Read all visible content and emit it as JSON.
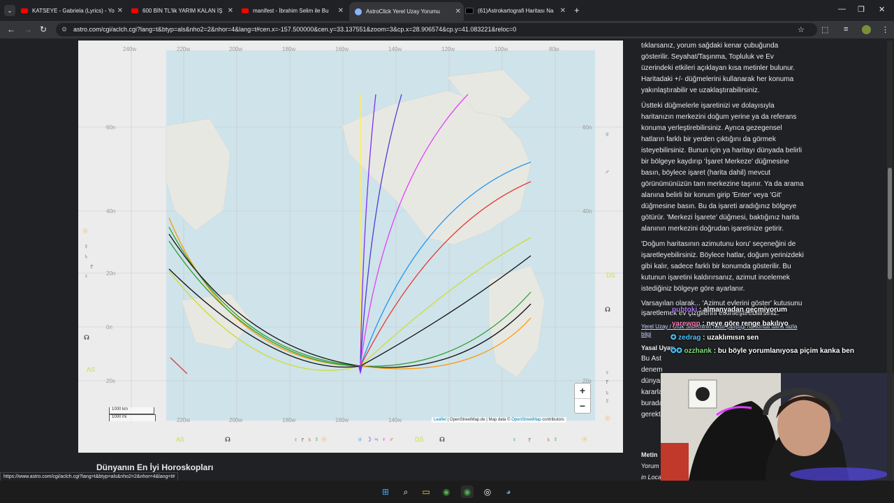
{
  "browser": {
    "tabs": [
      {
        "title": "KATSEYE - Gabriela (Lyrics) - Yo",
        "icon": "youtube-icon"
      },
      {
        "title": "600 BİN TL'lik YARIM KALAN İŞ",
        "icon": "youtube-icon"
      },
      {
        "title": "manifest - İbrahim Selim ile Bu",
        "icon": "youtube-icon"
      },
      {
        "title": "AstroClick Yerel Uzay Yorumu",
        "icon": "globe-icon"
      },
      {
        "title": "(61)Astrokartografi Haritası Na",
        "icon": "tiktok-icon"
      }
    ],
    "url": "astro.com/cgi/aclch.cgi?lang=t&btyp=als&nho2=2&nhor=4&lang=t#cen.x=-157.500000&cen.y=33.137551&zoom=3&cp.x=28.906574&cp.y=41.083221&reloc=0",
    "status_url": "https://www.astro.com/cgi/aclch.cgi?lang=t&btyp=als&nho2=2&nhor=4&lang=t#"
  },
  "map": {
    "lon_top": [
      "240w",
      "220w",
      "200w",
      "180w",
      "160w",
      "140w",
      "120w",
      "100w",
      "80w"
    ],
    "lon_bottom": [
      "220w",
      "200w",
      "180w",
      "160w",
      "140w"
    ],
    "lat": [
      "60n",
      "40n",
      "20n",
      "0n",
      "20s"
    ],
    "zoom_in": "+",
    "zoom_out": "−",
    "attribution": {
      "leaflet": "Leaflet",
      "sep1": " | OpenStreetMap.de | Map data © ",
      "osm": "OpenStreetMap",
      "contrib": " contributors"
    },
    "scale_km": "1000 km",
    "scale_mi": "1000 mi",
    "left_glyphs": [
      "☉",
      "☿",
      "♄",
      "♇",
      "♀",
      "☊"
    ],
    "left_labels": [
      "AS"
    ],
    "right_glyphs": [
      "♅",
      "♂",
      "☊",
      "♀",
      "♇",
      "♄",
      "☿",
      "☉"
    ],
    "right_labels": [
      "DS"
    ],
    "bottom_labels": [
      "AS",
      "DS"
    ],
    "bottom_glyphs": [
      "☊",
      "♀",
      "♇",
      "♄",
      "☿",
      "☉",
      "♅",
      "☽",
      "♃",
      "♆",
      "♂",
      "☊",
      "♀",
      "♇",
      "♄",
      "☿",
      "☉"
    ],
    "line_colors": {
      "purple": "#7b2ff7",
      "darkblue": "#4b3bd6",
      "magenta": "#e040fb",
      "lightblue": "#2196f3",
      "red": "#e53935",
      "yellowgreen": "#cddc39",
      "black": "#111111",
      "green": "#2e9e2e",
      "orange": "#ff9800",
      "yellow": "#ffee58"
    }
  },
  "sidebar": {
    "p1": "tıklarsanız, yorum sağdaki kenar çubuğunda gösterilir. Seyahat/Taşınma, Topluluk ve Ev üzerindeki etkileri açıklayan kısa metinler bulunur. Haritadaki +/- düğmelerini kullanarak her konuma yakınlaştırabilir ve uzaklaştırabilirsiniz.",
    "p2": "Üstteki düğmelerle işaretinizi ve dolayısıyla haritanızın merkezini doğum yerine ya da referans konuma yerleştirebilirsiniz. Ayrıca gezegensel hatların farklı bir yerden çıktığını da görmek isteyebilirsiniz. Bunun için ya haritayı dünyada belirli bir bölgeye kaydırıp 'İşaret Merkeze' düğmesine basın, böylece işaret (harita dahil) mevcut görünümünüzün tam merkezine taşınır. Ya da arama alanına belirli bir konum girip 'Enter' veya 'Git' düğmesine basın. Bu da işareti aradığınız bölgeye götürür. 'Merkezi İşarete' düğmesi, baktığınız harita alanının merkezini doğrudan işaretinize getirir.",
    "p3": "'Doğum haritasının azimutunu koru' seçeneğini de işaretleyebilirsiniz. Böylece hatlar, doğum yerinizdeki gibi kalır, sadece farklı bir konumda gösterilir. Bu kutunun işaretini kaldırırsanız, azimut incelemek istediğiniz bölgeye göre ayarlanır.",
    "p4": "Varsayılan olarak... 'Azimut evlerini göster' kutusunu işaretlemek ev çizgilerini etkinleştirebilirsiniz.",
    "link": "Yerel Uzay / Ufuk Sisteminin nasıl çalıştığı hakkında daha fazla bilgi",
    "heading1": "Yasal Uyarı",
    "frag1": "Bu Ast",
    "frag2": "denem",
    "frag3": "dünyar",
    "frag4": "kararla",
    "frag5": "burada",
    "frag6": "gerekt",
    "heading2": "Metin",
    "frag7": "Yorum",
    "frag8": "in Loca"
  },
  "chat": [
    {
      "user": "pubtoki",
      "sep": " : ",
      "msg": "almanyadan geçmiyorum"
    },
    {
      "user": "yarewqp",
      "sep": " : ",
      "msg": "neye göre renge bakılıyo"
    },
    {
      "user": "zedrag",
      "sep": " : ",
      "msg": "uzaklımısın sen"
    },
    {
      "user": "ozzhank",
      "sep": " : ",
      "msg": "bu böyle yorumlanıyosa piçim kanka ben"
    }
  ],
  "page": {
    "bottom_heading": "Dünyanın En İyi Horoskopları"
  }
}
